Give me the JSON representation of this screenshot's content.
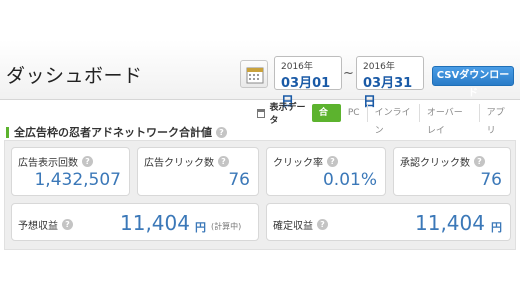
{
  "header": {
    "title": "ダッシュボード",
    "start_date": {
      "year": "2016年",
      "monthday": "03月01日"
    },
    "end_date": {
      "year": "2016年",
      "monthday": "03月31日"
    },
    "range_separator": "~",
    "csv_button": "CSVダウンロード"
  },
  "data_tabs": {
    "label": "表示データ",
    "tabs": [
      "合計",
      "PC",
      "インライン",
      "オーバーレイ",
      "アプリ"
    ],
    "active": "合計"
  },
  "summary": {
    "title": "全広告枠の忍者アドネットワーク合計値",
    "metrics": [
      {
        "label": "広告表示回数",
        "value": "1,432,507"
      },
      {
        "label": "広告クリック数",
        "value": "76"
      },
      {
        "label": "クリック率",
        "value": "0.01%"
      },
      {
        "label": "承認クリック数",
        "value": "76"
      }
    ],
    "estimated": {
      "label": "予想収益",
      "amount": "11,404",
      "currency": "円",
      "note": "(計算中)"
    },
    "confirmed": {
      "label": "確定収益",
      "amount": "11,404",
      "currency": "円"
    }
  },
  "colors": {
    "accent_green": "#5cb32e",
    "value_blue": "#3b78b8",
    "date_blue": "#1a5aa6",
    "button_blue": "#2a7cc8"
  },
  "icons": {
    "calendar": "calendar-icon",
    "help": "help-icon",
    "data": "data-view-icon"
  }
}
